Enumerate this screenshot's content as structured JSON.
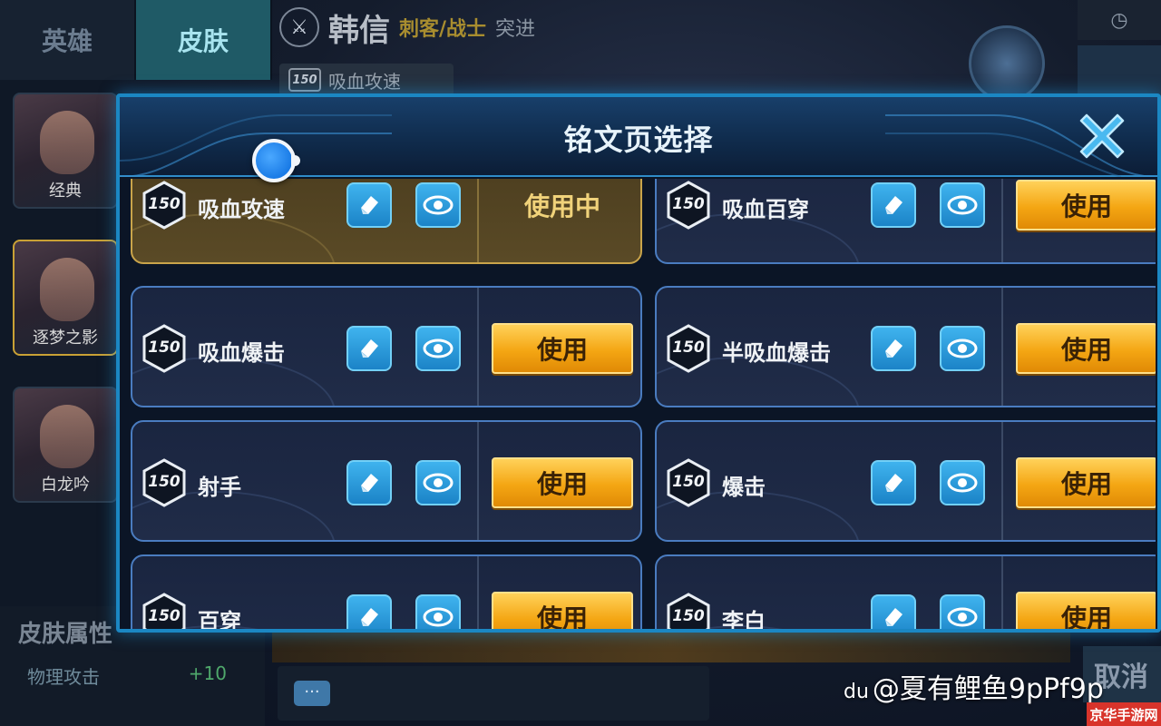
{
  "background": {
    "tabs": [
      {
        "label": "英雄"
      },
      {
        "label": "皮肤"
      }
    ],
    "hero": {
      "name": "韩信",
      "role": "刺客/战士",
      "tag": "突进"
    },
    "current_rune": {
      "badge": "150",
      "name": "吸血攻速"
    },
    "skins": [
      {
        "label": "经典"
      },
      {
        "label": "逐梦之影"
      },
      {
        "label": "白龙吟"
      }
    ],
    "skin_attributes": {
      "title": "皮肤属性",
      "label": "物理攻击",
      "value": "+10"
    },
    "bottom_right_label": "取消"
  },
  "modal": {
    "title": "铭文页选择",
    "use_label": "使用",
    "in_use_label": "使用中",
    "pages": [
      {
        "level": "150",
        "name": "吸血攻速",
        "in_use": true
      },
      {
        "level": "150",
        "name": "吸血百穿",
        "in_use": false
      },
      {
        "level": "150",
        "name": "吸血爆击",
        "in_use": false
      },
      {
        "level": "150",
        "name": "半吸血爆击",
        "in_use": false
      },
      {
        "level": "150",
        "name": "射手",
        "in_use": false
      },
      {
        "level": "150",
        "name": "爆击",
        "in_use": false
      },
      {
        "level": "150",
        "name": "百穿",
        "in_use": false
      },
      {
        "level": "150",
        "name": "李白",
        "in_use": false
      }
    ]
  },
  "watermark": {
    "text": "@夏有鲤鱼9pPf9p",
    "logo": "du",
    "site": "京华手游网"
  },
  "colors": {
    "accent_blue": "#1b87c3",
    "use_button": "#f4a613",
    "in_use_gold": "#c9a44a"
  },
  "icons": {
    "close": "close-x-icon",
    "edit": "eraser-edit-icon",
    "view": "eye-icon",
    "level": "hexagon-level-badge"
  }
}
